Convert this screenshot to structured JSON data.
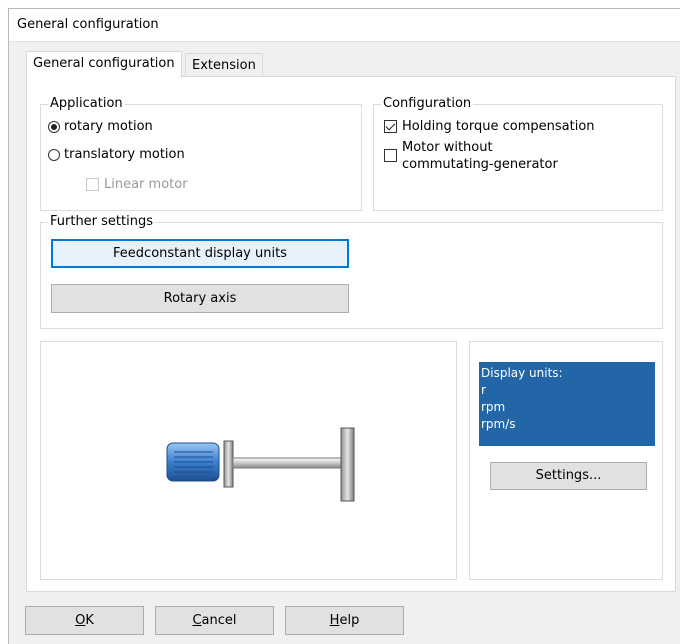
{
  "window": {
    "title": "General configuration"
  },
  "tabs": [
    {
      "label": "General configuration",
      "active": true
    },
    {
      "label": "Extension",
      "active": false
    }
  ],
  "application": {
    "title": "Application",
    "rotary_label": "rotary motion",
    "rotary_selected": true,
    "translatory_label": "translatory motion",
    "translatory_selected": false,
    "linear_motor_label": "Linear motor",
    "linear_motor_checked": false,
    "linear_motor_enabled": false
  },
  "configuration": {
    "title": "Configuration",
    "holding_torque_label": "Holding torque compensation",
    "holding_torque_checked": true,
    "motor_without_line1": "Motor without",
    "motor_without_line2": "commutating-generator",
    "motor_without_checked": false
  },
  "further_settings": {
    "title": "Further settings",
    "feedconstant_button": "Feedconstant display units",
    "rotary_axis_button": "Rotary axis"
  },
  "display_units": {
    "header": "Display units:",
    "lines": [
      "r",
      "rpm",
      "rpm/s"
    ],
    "settings_button": "Settings..."
  },
  "footer": {
    "ok": {
      "underline": "O",
      "rest": "K"
    },
    "cancel": {
      "underline": "C",
      "rest": "ancel"
    },
    "help": {
      "underline": "H",
      "rest": "elp"
    }
  },
  "colors": {
    "display_box": "#2366a8",
    "motor_blue": "#3a7fd0",
    "focus_border": "#0078d7"
  },
  "icons": [
    "motor-illustration"
  ]
}
